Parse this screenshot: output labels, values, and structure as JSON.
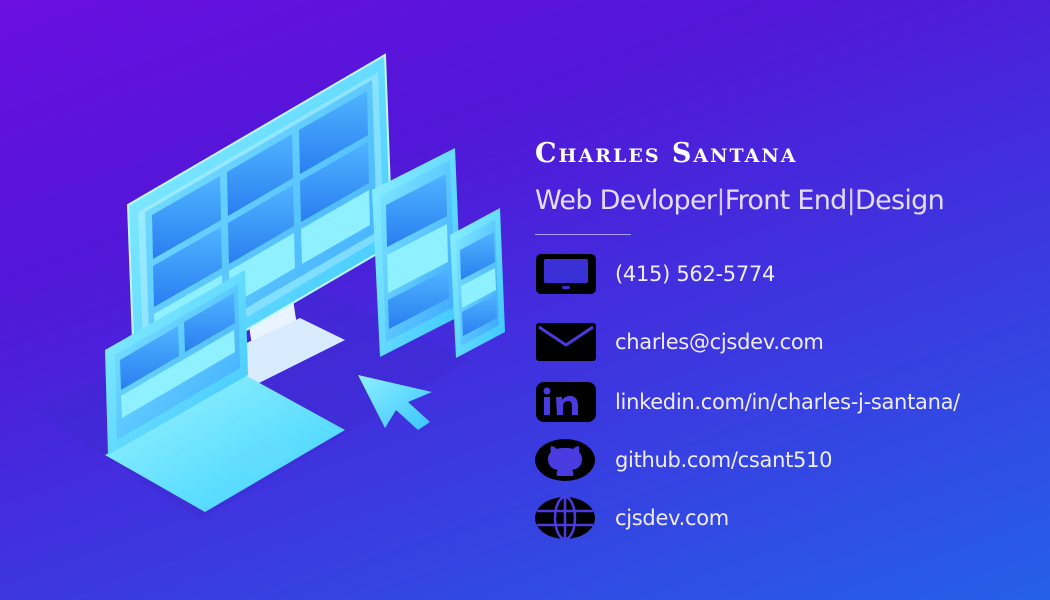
{
  "profile": {
    "name": "Charles Santana",
    "role_parts": [
      "Web Devloper",
      "Front End",
      "Design"
    ],
    "role_separator": "|"
  },
  "contacts": [
    {
      "icon": "tablet-icon",
      "text": "(415) 562-5774"
    },
    {
      "icon": "envelope-icon",
      "text": "charles@cjsdev.com"
    },
    {
      "icon": "linkedin-icon",
      "text": "linkedin.com/in/charles-j-santana/"
    },
    {
      "icon": "github-icon",
      "text": "github.com/csant510"
    },
    {
      "icon": "globe-icon",
      "text": "cjsdev.com"
    }
  ],
  "colors": {
    "background_top": "#6a0fe0",
    "background_bottom": "#2560e8",
    "device_accent": "#5fe3ff",
    "text": "#ffffff"
  }
}
